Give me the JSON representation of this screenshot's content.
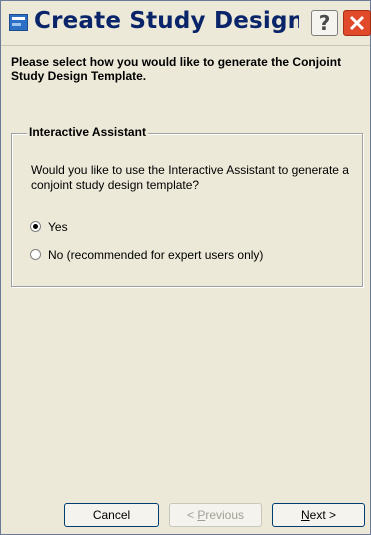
{
  "window": {
    "title": "Create Study Design T...",
    "help_label": "?",
    "icons": {
      "app": "app-icon",
      "help": "help-icon",
      "close": "close-icon"
    }
  },
  "intro_text": "Please select how you would like to generate the Conjoint Study Design Template.",
  "group": {
    "legend": "Interactive Assistant",
    "question": "Would you like to use the Interactive Assistant to generate a conjoint study design template?",
    "options": [
      {
        "label": "Yes",
        "checked": true
      },
      {
        "label": "No (recommended for expert users only)",
        "checked": false
      }
    ]
  },
  "buttons": {
    "cancel": "Cancel",
    "previous_prefix": "< ",
    "previous_key": "P",
    "previous_rest": "revious",
    "next_key": "N",
    "next_rest": "ext >"
  },
  "colors": {
    "title": "#0a246a",
    "close": "#e0492a",
    "background": "#ece9d8"
  }
}
